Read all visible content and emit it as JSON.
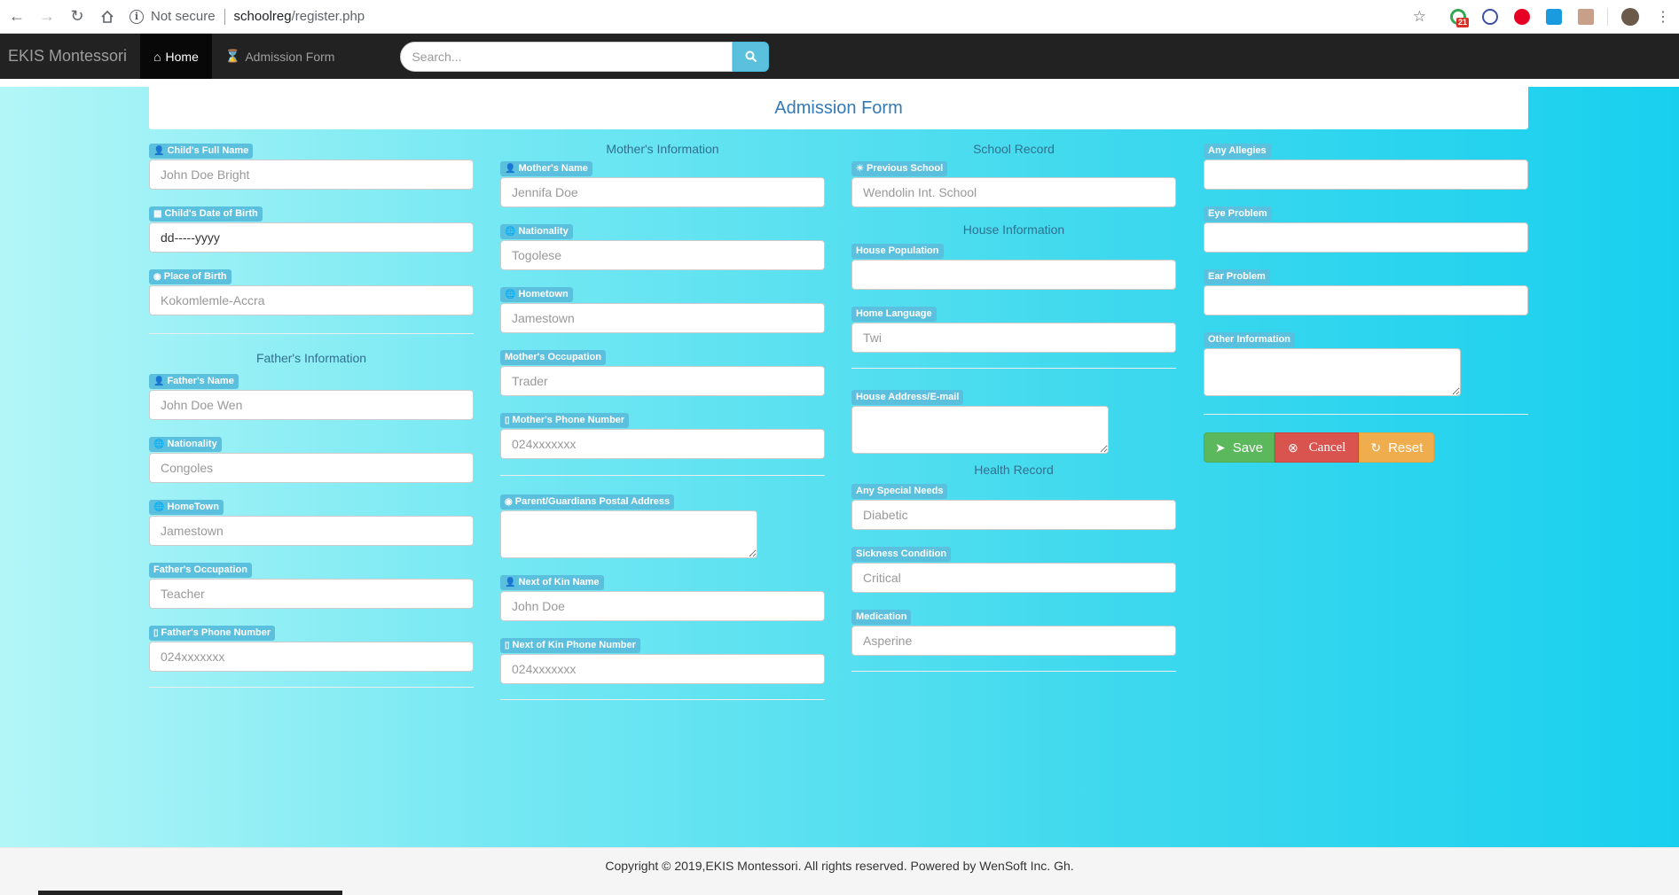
{
  "browser": {
    "security": "Not secure",
    "url_host": "schoolreg",
    "url_path": "/register.php",
    "extension_badge": "21"
  },
  "navbar": {
    "brand": "EKIS Montessori",
    "home": "Home",
    "admission": "Admission Form",
    "search_placeholder": "Search..."
  },
  "form": {
    "title": "Admission Form",
    "col1": {
      "child_name_label": "Child's Full Name",
      "child_name_ph": "John Doe Bright",
      "child_dob_label": "Child's Date of Birth",
      "child_dob_value": "dd-----yyyy",
      "place_birth_label": "Place of Birth",
      "place_birth_ph": "Kokomlemle-Accra",
      "father_section": "Father's Information",
      "father_name_label": "Father's Name",
      "father_name_ph": "John Doe Wen",
      "nationality_label": "Nationality",
      "nationality_ph": "Congoles",
      "hometown_label": "HomeTown",
      "hometown_ph": "Jamestown",
      "occupation_label": "Father's Occupation",
      "occupation_ph": "Teacher",
      "phone_label": "Father's Phone Number",
      "phone_ph": "024xxxxxxx"
    },
    "col2": {
      "mother_section": "Mother's Information",
      "mother_name_label": "Mother's Name",
      "mother_name_ph": "Jennifa Doe",
      "nationality_label": "Nationality",
      "nationality_ph": "Togolese",
      "hometown_label": "Hometown",
      "hometown_ph": "Jamestown",
      "occupation_label": "Mother's Occupation",
      "occupation_ph": "Trader",
      "phone_label": "Mother's Phone Number",
      "phone_ph": "024xxxxxxx",
      "postal_label": "Parent/Guardians Postal Address",
      "kin_name_label": "Next of Kin Name",
      "kin_name_ph": "John Doe",
      "kin_phone_label": "Next of Kin Phone Number",
      "kin_phone_ph": "024xxxxxxx"
    },
    "col3": {
      "school_section": "School Record",
      "prev_school_label": "Previous School",
      "prev_school_ph": "Wendolin Int. School",
      "house_section": "House Information",
      "house_pop_label": "House Population",
      "home_lang_label": "Home Language",
      "home_lang_ph": "Twi",
      "house_addr_label": "House Address/E-mail",
      "health_section": "Health Record",
      "special_needs_label": "Any Special Needs",
      "special_needs_ph": "Diabetic",
      "sickness_label": "Sickness Condition",
      "sickness_ph": "Critical",
      "medication_label": "Medication",
      "medication_ph": "Asperine"
    },
    "col4": {
      "allergies_label": "Any Allegies",
      "eye_label": "Eye Problem",
      "ear_label": "Ear Problem",
      "other_label": "Other Information",
      "save": "Save",
      "cancel": "Cancel",
      "reset": "Reset"
    }
  },
  "footer": {
    "text": "Copyright © 2019,EKIS Montessori. All rights reserved. Powered by WenSoft Inc. Gh."
  },
  "colors": {
    "label_bg": "#5bc0de",
    "navbar_bg": "#222222",
    "title_color": "#337ab7",
    "save": "#5cb85c",
    "cancel": "#d9534f",
    "reset": "#f0ad4e"
  }
}
